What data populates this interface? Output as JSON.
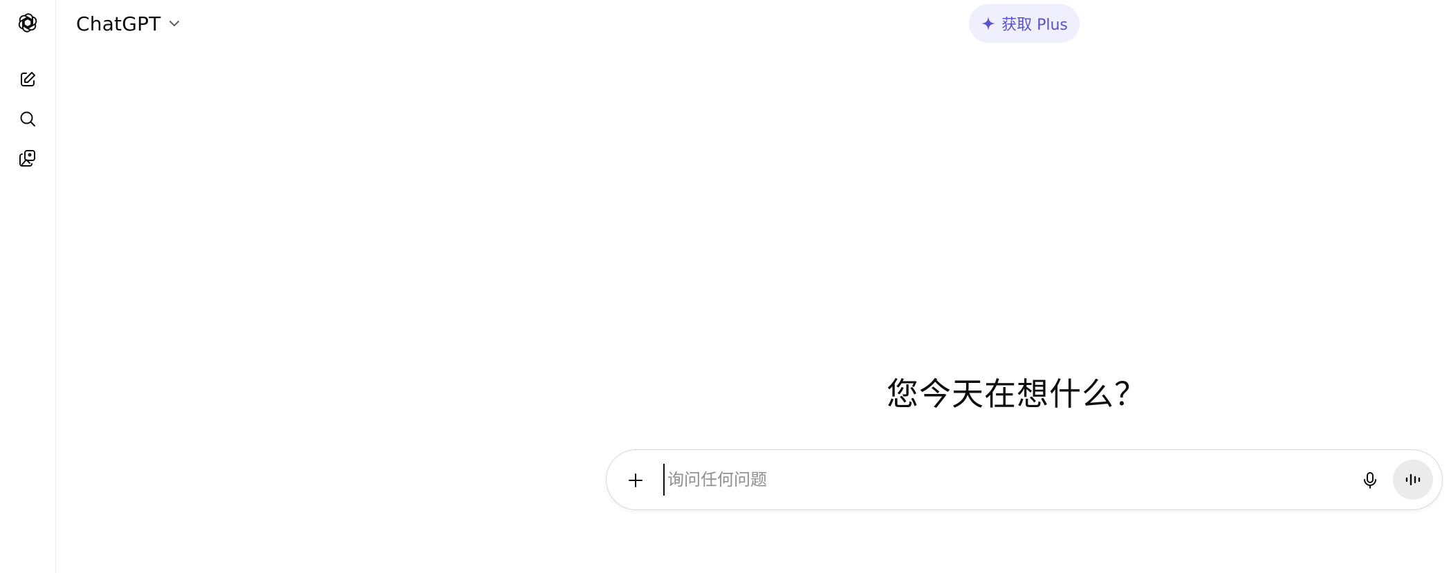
{
  "header": {
    "model_name": "ChatGPT",
    "upgrade_label": "获取 Plus"
  },
  "sidebar": {
    "icons": [
      "openai-logo-icon",
      "new-chat-icon",
      "search-icon",
      "library-icon"
    ]
  },
  "main": {
    "greeting": "您今天在想什么？"
  },
  "composer": {
    "placeholder": "询问任何问题"
  },
  "colors": {
    "accent": "#5b53c9",
    "accent_bg": "#f0effd",
    "text": "#0d0d0d",
    "placeholder": "#8f8f8f",
    "voice_bg": "#ebebeb"
  }
}
